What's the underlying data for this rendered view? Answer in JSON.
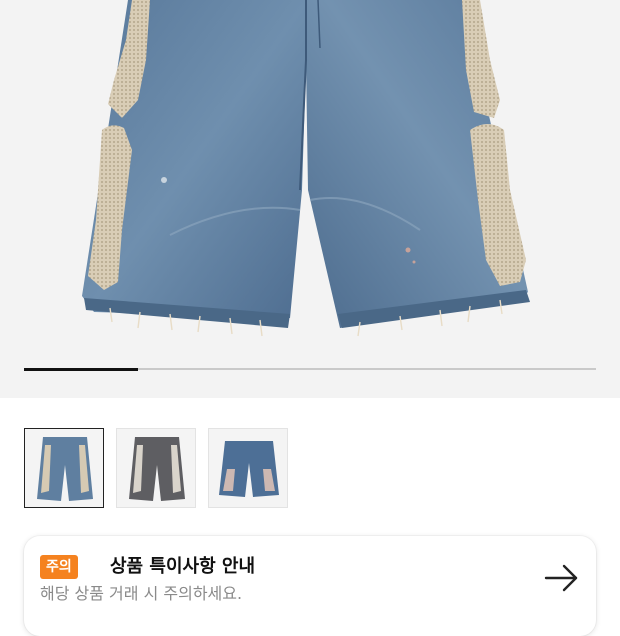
{
  "product": {
    "main_image_alt": "denim shorts with bone embroidery",
    "gallery_progress": 0.2,
    "thumbnails": [
      {
        "name": "light-wash",
        "selected": true
      },
      {
        "name": "grey-wash",
        "selected": false
      },
      {
        "name": "indigo-wash",
        "selected": false
      }
    ]
  },
  "notice": {
    "badge": "주의",
    "title": "상품 특이사항 안내",
    "subtitle": "해당 상품 거래 시 주의하세요.",
    "arrow_icon": "arrow-right-icon"
  },
  "colors": {
    "accent": "#f5821f",
    "hero_background": "#f3f3f3",
    "progress_fill": "#111111",
    "progress_track": "#c9c9c9"
  }
}
